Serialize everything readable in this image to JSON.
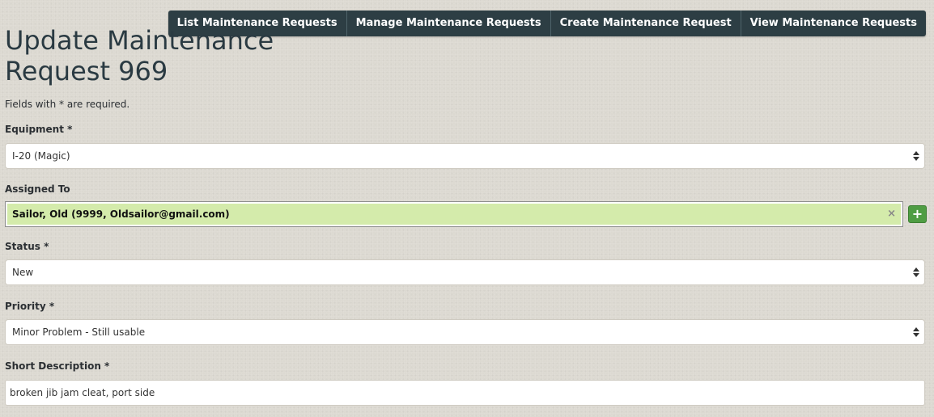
{
  "nav": {
    "items": [
      "List Maintenance Requests",
      "Manage Maintenance Requests",
      "Create Maintenance Request",
      "View Maintenance Requests"
    ]
  },
  "page": {
    "title": "Update Maintenance Request 969",
    "required_note": "Fields with * are required."
  },
  "form": {
    "equipment": {
      "label": "Equipment *",
      "value": "I-20 (Magic)",
      "icon": "select-arrows-icon"
    },
    "assigned_to": {
      "label": "Assigned To",
      "value": "Sailor, Old (9999, Oldsailor@gmail.com)",
      "clear_glyph": "×",
      "add_glyph": "+"
    },
    "status": {
      "label": "Status *",
      "value": "New",
      "icon": "select-arrows-icon"
    },
    "priority": {
      "label": "Priority *",
      "value": "Minor Problem - Still usable",
      "icon": "select-arrows-icon"
    },
    "short_description": {
      "label": "Short Description *",
      "value": "broken jib jam cleat, port side"
    }
  },
  "colors": {
    "nav_bg": "#2d3e44",
    "assigned_chip_bg": "#d4ebab",
    "add_button_bg": "#4f9d43",
    "page_bg": "#dcd9d1"
  }
}
